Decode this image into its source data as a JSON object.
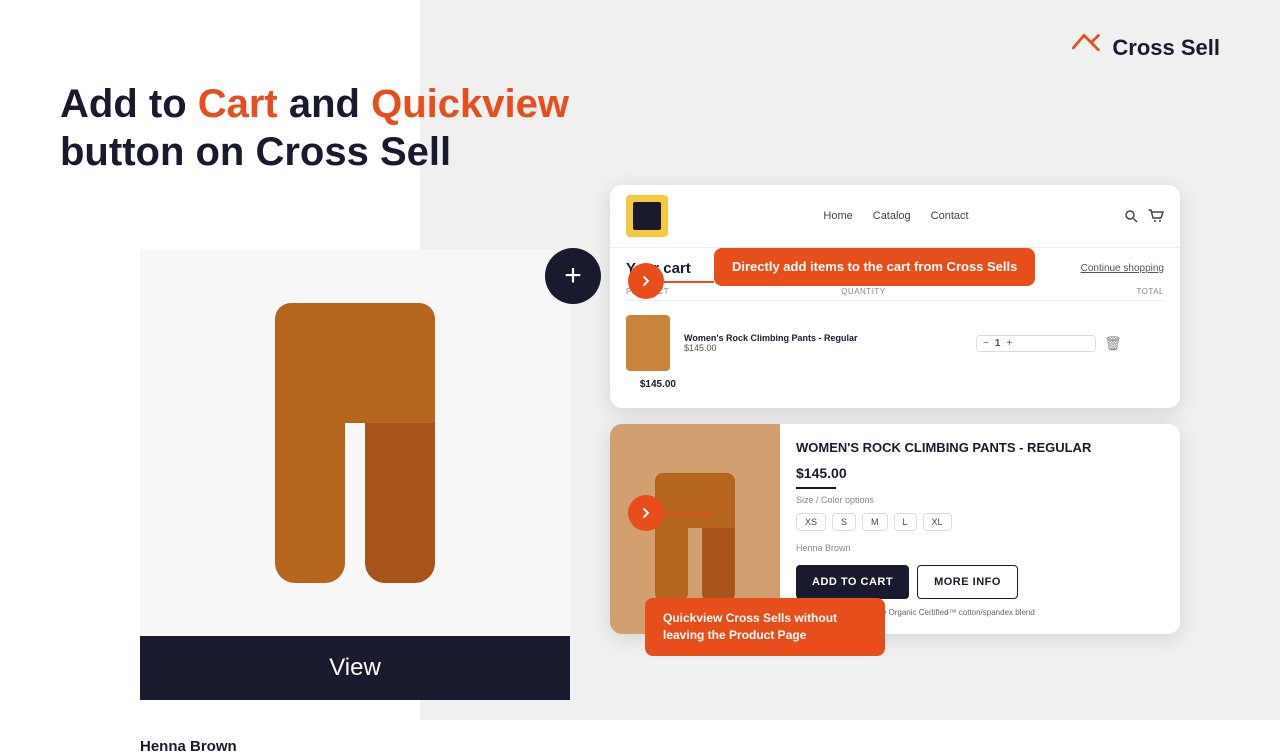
{
  "logo": {
    "text": "Cross Sell",
    "icon_alt": "cross-sell-logo"
  },
  "headline": {
    "line1_prefix": "Add to ",
    "line1_cart": "Cart",
    "line1_middle": " and ",
    "line1_quickview": "Quickview",
    "line2": "button on Cross Sell"
  },
  "product": {
    "name": "Henna Brown",
    "view_label": "View"
  },
  "store": {
    "nav_items": [
      "Home",
      "Catalog",
      "Contact"
    ]
  },
  "cart": {
    "title": "Your cart",
    "continue_label": "Continue shopping",
    "table_headers": [
      "PRODUCT",
      "QUANTITY",
      "TOTAL"
    ],
    "item": {
      "name": "Women's Rock Climbing Pants - Regular",
      "price": "$145.00",
      "quantity": 1,
      "total": "$145.00"
    }
  },
  "callout_top": {
    "text": "Directly add items to the cart from Cross Sells"
  },
  "quickview": {
    "product_name": "WOMEN'S ROCK CLIMBING PANTS - REGULAR",
    "price": "$145.00",
    "color_label": "Henna Brown",
    "description": "Lightweight Regenerative Organic Certified™ cotton/spandex blend",
    "add_cart_label": "ADD TO CART",
    "more_info_label": "MORE INFO"
  },
  "callout_bottom": {
    "text": "Quickview Cross Sells without leaving the Product Page"
  }
}
